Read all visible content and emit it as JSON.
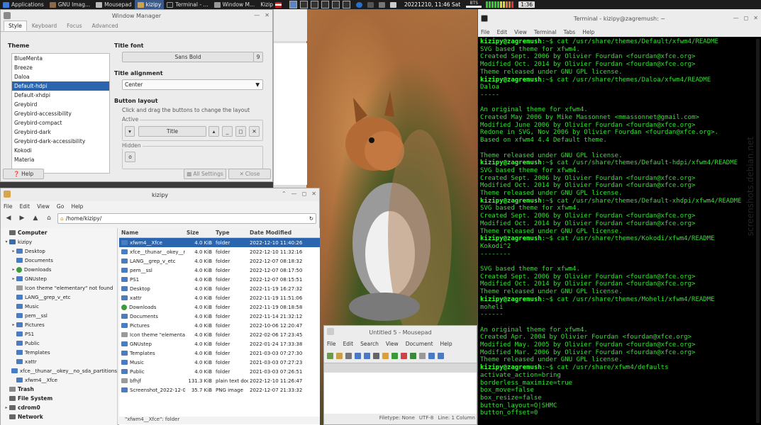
{
  "panel": {
    "applications": "Applications",
    "tasks": [
      "GNU Imag...",
      "Mousepad",
      "kizipy",
      "Terminal - ...",
      "Window M...",
      "Kizip"
    ],
    "active_task_index": 2,
    "clock": "20221210, 11:46 Sat",
    "bts_label": "BTS",
    "battery": "1:36"
  },
  "wm": {
    "title": "Window Manager",
    "tabs": [
      "Style",
      "Keyboard",
      "Focus",
      "Advanced"
    ],
    "theme_heading": "Theme",
    "themes": [
      "BlueMenta",
      "Breeze",
      "Daloa",
      "Default-hdpi",
      "Default-xhdpi",
      "Greybird",
      "Greybird-accessibility",
      "Greybird-compact",
      "Greybird-dark",
      "Greybird-dark-accessibility",
      "Kokodi",
      "Materia"
    ],
    "selected_theme_index": 3,
    "title_font_heading": "Title font",
    "title_font_value": "Sans Bold",
    "title_font_size": "9",
    "title_alignment_heading": "Title alignment",
    "title_alignment_value": "Center",
    "button_layout_heading": "Button layout",
    "button_layout_hint": "Click and drag the buttons to change the layout",
    "active_label": "Active",
    "title_button": "Title",
    "hidden_label": "Hidden",
    "help_button": "Help",
    "all_settings_button": "All Settings",
    "close_button": "Close"
  },
  "fm": {
    "title": "kizipy",
    "menu": [
      "File",
      "Edit",
      "View",
      "Go",
      "Help"
    ],
    "location": "/home/kizipy/",
    "sidebar": [
      {
        "label": "Computer",
        "type": "header",
        "exp": "",
        "icon": "drive",
        "indent": 0
      },
      {
        "label": "kizipy",
        "type": "item",
        "exp": "▾",
        "icon": "home",
        "indent": 0
      },
      {
        "label": "Desktop",
        "type": "item",
        "exp": "▸",
        "icon": "folder",
        "indent": 1
      },
      {
        "label": "Documents",
        "type": "item",
        "exp": "",
        "icon": "folder",
        "indent": 1
      },
      {
        "label": "Downloads",
        "type": "item",
        "exp": "▸",
        "icon": "green",
        "indent": 1
      },
      {
        "label": "GNUstep",
        "type": "item",
        "exp": "▸",
        "icon": "folder",
        "indent": 1
      },
      {
        "label": "Icon theme \"elementary\" not found",
        "type": "item",
        "exp": "",
        "icon": "gray",
        "indent": 1
      },
      {
        "label": "LANG__grep_v_etc",
        "type": "item",
        "exp": "",
        "icon": "folder",
        "indent": 1
      },
      {
        "label": "Music",
        "type": "item",
        "exp": "",
        "icon": "folder",
        "indent": 1
      },
      {
        "label": "pem__ssl",
        "type": "item",
        "exp": "",
        "icon": "folder",
        "indent": 1
      },
      {
        "label": "Pictures",
        "type": "item",
        "exp": "▸",
        "icon": "folder",
        "indent": 1
      },
      {
        "label": "PS1",
        "type": "item",
        "exp": "",
        "icon": "folder",
        "indent": 1
      },
      {
        "label": "Public",
        "type": "item",
        "exp": "",
        "icon": "folder",
        "indent": 1
      },
      {
        "label": "Templates",
        "type": "item",
        "exp": "",
        "icon": "folder",
        "indent": 1
      },
      {
        "label": "xattr",
        "type": "item",
        "exp": "",
        "icon": "folder",
        "indent": 1
      },
      {
        "label": "xfce__thunar__okey__no_sda_partitions",
        "type": "item",
        "exp": "",
        "icon": "folder",
        "indent": 1
      },
      {
        "label": "xfwm4__Xfce",
        "type": "item",
        "exp": "",
        "icon": "folder",
        "indent": 1
      },
      {
        "label": "Trash",
        "type": "header",
        "exp": "",
        "icon": "trash",
        "indent": 0
      },
      {
        "label": "File System",
        "type": "header",
        "exp": "",
        "icon": "drive",
        "indent": 0
      },
      {
        "label": "cdrom0",
        "type": "header",
        "exp": "▸",
        "icon": "drive",
        "indent": 0
      },
      {
        "label": "Network",
        "type": "header",
        "exp": "",
        "icon": "drive",
        "indent": 0
      }
    ],
    "columns": [
      "Name",
      "Size",
      "Type",
      "Date Modified"
    ],
    "files": [
      {
        "name": "xfwm4__Xfce",
        "size": "4.0 KiB",
        "type": "folder",
        "date": "2022-12-10 11:40:26",
        "icon": "folder"
      },
      {
        "name": "xfce__thunar__okey__no_sda_partitions",
        "size": "4.0 KiB",
        "type": "folder",
        "date": "2022-12-10 11:32:16",
        "icon": "folder"
      },
      {
        "name": "LANG__grep_v_etc",
        "size": "4.0 KiB",
        "type": "folder",
        "date": "2022-12-07 08:18:32",
        "icon": "folder"
      },
      {
        "name": "pem__ssl",
        "size": "4.0 KiB",
        "type": "folder",
        "date": "2022-12-07 08:17:50",
        "icon": "folder"
      },
      {
        "name": "PS1",
        "size": "4.0 KiB",
        "type": "folder",
        "date": "2022-12-07 08:15:51",
        "icon": "folder"
      },
      {
        "name": "Desktop",
        "size": "4.0 KiB",
        "type": "folder",
        "date": "2022-11-19 16:27:32",
        "icon": "folder"
      },
      {
        "name": "xattr",
        "size": "4.0 KiB",
        "type": "folder",
        "date": "2022-11-19 11:51:06",
        "icon": "folder"
      },
      {
        "name": "Downloads",
        "size": "4.0 KiB",
        "type": "folder",
        "date": "2022-11-19 08:18:58",
        "icon": "green"
      },
      {
        "name": "Documents",
        "size": "4.0 KiB",
        "type": "folder",
        "date": "2022-11-14 21:32:12",
        "icon": "folder"
      },
      {
        "name": "Pictures",
        "size": "4.0 KiB",
        "type": "folder",
        "date": "2022-10-06 12:20:47",
        "icon": "folder"
      },
      {
        "name": "Icon theme \"elementary\" not found",
        "size": "4.0 KiB",
        "type": "folder",
        "date": "2022-02-06 17:23:45",
        "icon": "gray"
      },
      {
        "name": "GNUstep",
        "size": "4.0 KiB",
        "type": "folder",
        "date": "2022-01-24 17:33:38",
        "icon": "folder"
      },
      {
        "name": "Templates",
        "size": "4.0 KiB",
        "type": "folder",
        "date": "2021-03-03 07:27:30",
        "icon": "folder"
      },
      {
        "name": "Music",
        "size": "4.0 KiB",
        "type": "folder",
        "date": "2021-03-03 07:27:23",
        "icon": "folder"
      },
      {
        "name": "Public",
        "size": "4.0 KiB",
        "type": "folder",
        "date": "2021-03-03 07:26:51",
        "icon": "folder"
      },
      {
        "name": "bfhjf",
        "size": "131.3 KiB",
        "type": "plain text document",
        "date": "2022-12-10 11:26:47",
        "icon": "gray"
      },
      {
        "name": "Screenshot_2022-12-07_21-33-32.png",
        "size": "35.7 KiB",
        "type": "PNG image",
        "date": "2022-12-07 21:33:32",
        "icon": "folder"
      }
    ],
    "selected_file_index": 0,
    "status": "\"xfwm4__Xfce\": folder"
  },
  "mousepad": {
    "title": "Untitled 5 - Mousepad",
    "menu": [
      "File",
      "Edit",
      "Search",
      "View",
      "Document",
      "Help"
    ],
    "filetype": "Filetype: None",
    "encoding": "UTF-8",
    "position": "Line: 1 Column"
  },
  "terminal": {
    "title": "Terminal - kizipy@zagremush: ~",
    "menu": [
      "File",
      "Edit",
      "View",
      "Terminal",
      "Tabs",
      "Help"
    ],
    "lines": [
      {
        "p": "kizipy@zagremush",
        "c": ":~$ cat /usr/share/themes/Default/xfwm4/README"
      },
      {
        "t": "SVG based theme for xfwm4."
      },
      {
        "t": "Created Sept. 2006 by Olivier Fourdan <fourdan@xfce.org>"
      },
      {
        "t": "Modified Oct. 2014 by Olivier Fourdan <fourdan@xfce.org>"
      },
      {
        "t": "Theme released under GNU GPL license."
      },
      {
        "p": "kizipy@zagremush",
        "c": ":~$ cat /usr/share/themes/Daloa/xfwm4/README"
      },
      {
        "t": "Daloa"
      },
      {
        "t": "-----"
      },
      {
        "t": ""
      },
      {
        "t": "An original theme for xfwm4."
      },
      {
        "t": "Created May 2006 by Mike Massonnet <mmassonnet@gmail.com>"
      },
      {
        "t": "Modified June 2006 by Olivier Fourdan <fourdan@xfce.org>"
      },
      {
        "t": "Redone in SVG, Nov 2006 by Olivier Fourdan <fourdan@xfce.org>."
      },
      {
        "t": "Based on xfwm4 4.4 Default theme."
      },
      {
        "t": ""
      },
      {
        "t": "Theme released under GNU GPL license."
      },
      {
        "p": "kizipy@zagremush",
        "c": ":~$ cat /usr/share/themes/Default-hdpi/xfwm4/README"
      },
      {
        "t": "SVG based theme for xfwm4."
      },
      {
        "t": "Created Sept. 2006 by Olivier Fourdan <fourdan@xfce.org>"
      },
      {
        "t": "Modified Oct. 2014 by Olivier Fourdan <fourdan@xfce.org>"
      },
      {
        "t": "Theme released under GNU GPL license."
      },
      {
        "p": "kizipy@zagremush",
        "c": ":~$ cat /usr/share/themes/Default-xhdpi/xfwm4/README"
      },
      {
        "t": "SVG based theme for xfwm4."
      },
      {
        "t": "Created Sept. 2006 by Olivier Fourdan <fourdan@xfce.org>"
      },
      {
        "t": "Modified Oct. 2014 by Olivier Fourdan <fourdan@xfce.org>"
      },
      {
        "t": "Theme released under GNU GPL license."
      },
      {
        "p": "kizipy@zagremush",
        "c": ":~$ cat /usr/share/themes/Kokodi/xfwm4/README"
      },
      {
        "t": "Kokodi^2"
      },
      {
        "t": "--------"
      },
      {
        "t": ""
      },
      {
        "t": "SVG based theme for xfwm4."
      },
      {
        "t": "Created Sept. 2006 by Olivier Fourdan <fourdan@xfce.org>"
      },
      {
        "t": "Modified Oct. 2014 by Olivier Fourdan <fourdan@xfce.org>"
      },
      {
        "t": "Theme released under GNU GPL license."
      },
      {
        "p": "kizipy@zagremush",
        "c": ":~$ cat /usr/share/themes/Moheli/xfwm4/README"
      },
      {
        "t": "moheli"
      },
      {
        "t": "------"
      },
      {
        "t": ""
      },
      {
        "t": "An original theme for xfwm4."
      },
      {
        "t": "Created Apr. 2004 by Olivier Fourdan <fourdan@xfce.org>"
      },
      {
        "t": "Modified May. 2005 by Olivier Fourdan <fourdan@xfce.org>"
      },
      {
        "t": "Modified Mar. 2006 by Olivier Fourdan <fourdan@xfce.org>"
      },
      {
        "t": "Theme released under GNU GPL license."
      },
      {
        "p": "kizipy@zagremush",
        "c": ":~$ cat /usr/share/xfwm4/defaults"
      },
      {
        "t": "activate_action=bring"
      },
      {
        "t": "borderless_maximize=true"
      },
      {
        "t": "box_move=false"
      },
      {
        "t": "box_resize=false"
      },
      {
        "t": "button_layout=O|SHMC"
      },
      {
        "t": "button_offset=0"
      }
    ]
  },
  "colors": {
    "selection": "#2b65b0",
    "terminal_text": "#33e033",
    "terminal_bg": "#000000"
  }
}
